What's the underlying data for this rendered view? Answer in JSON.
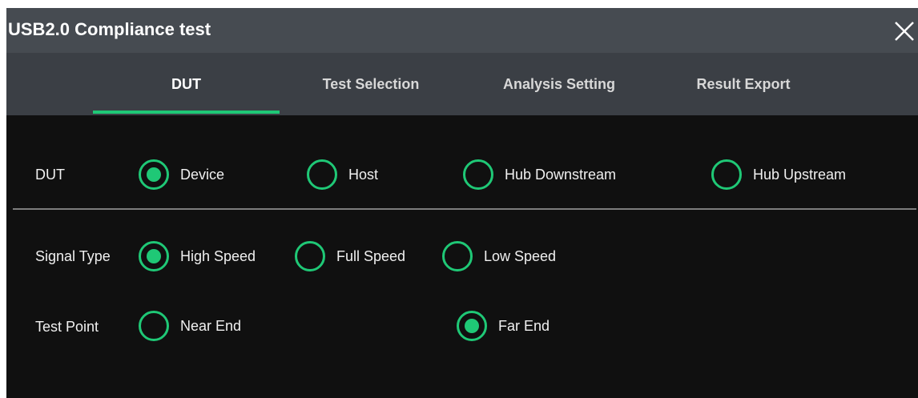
{
  "window": {
    "title": "USB2.0 Compliance test"
  },
  "tabs": [
    {
      "label": "DUT",
      "active": true
    },
    {
      "label": "Test Selection",
      "active": false
    },
    {
      "label": "Analysis Setting",
      "active": false
    },
    {
      "label": "Result Export",
      "active": false
    }
  ],
  "dut": {
    "label": "DUT",
    "options": [
      {
        "label": "Device",
        "selected": true
      },
      {
        "label": "Host",
        "selected": false
      },
      {
        "label": "Hub Downstream",
        "selected": false
      },
      {
        "label": "Hub Upstream",
        "selected": false
      }
    ]
  },
  "signal_type": {
    "label": "Signal Type",
    "options": [
      {
        "label": "High Speed",
        "selected": true
      },
      {
        "label": "Full Speed",
        "selected": false
      },
      {
        "label": "Low Speed",
        "selected": false
      }
    ]
  },
  "test_point": {
    "label": "Test Point",
    "options": [
      {
        "label": "Near End",
        "selected": false
      },
      {
        "label": "Far End",
        "selected": true
      }
    ]
  },
  "colors": {
    "accent": "#1fc876",
    "titlebar": "#464b51",
    "tabbar": "#3b3f45",
    "background": "#101010"
  }
}
